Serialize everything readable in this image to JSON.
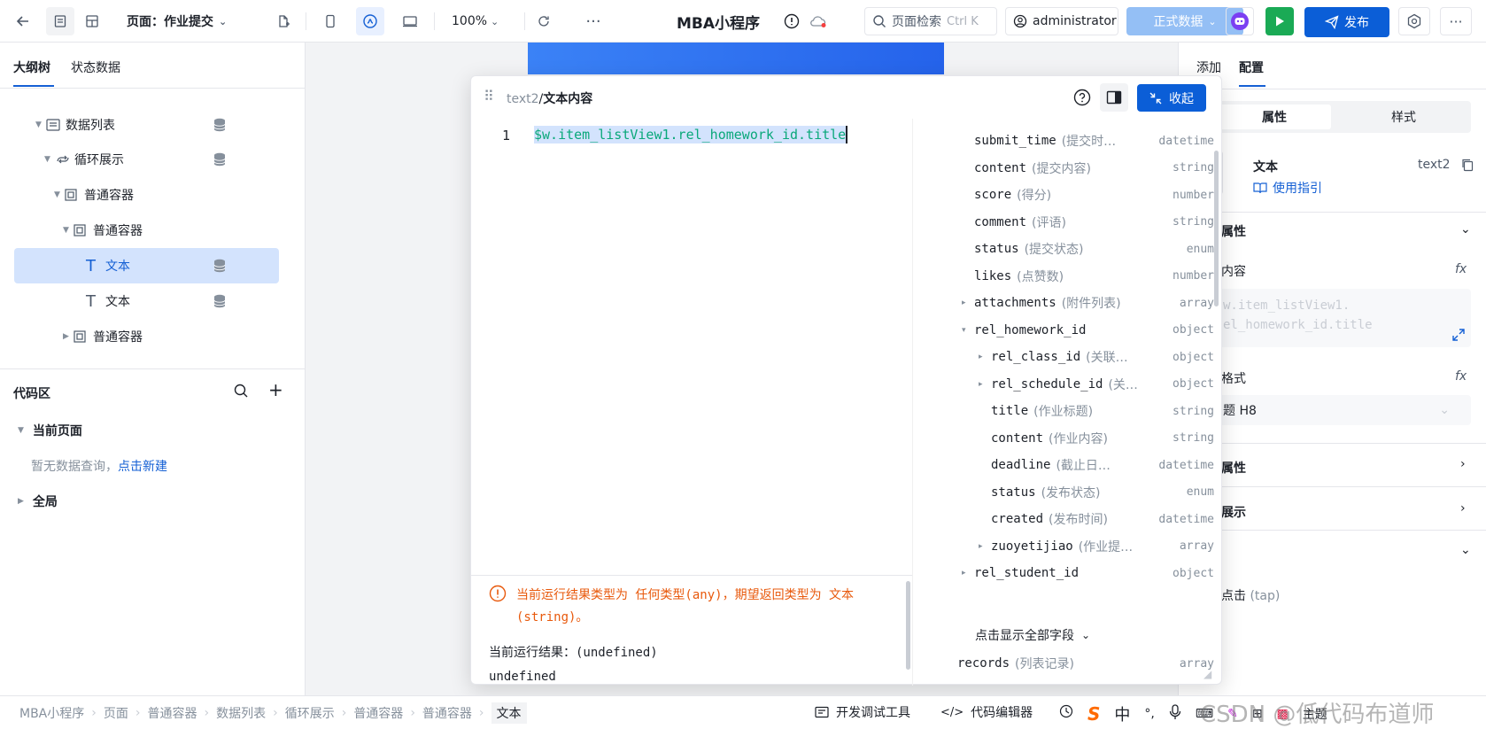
{
  "topbar": {
    "page_label": "页面：作业提交",
    "zoom": "100%",
    "app_title": "MBA小程序",
    "search_placeholder": "页面检索",
    "search_shortcut": "Ctrl K",
    "user": "administrator",
    "env": "正式数据",
    "publish": "发布"
  },
  "left": {
    "tabs": [
      "大纲树",
      "状态数据"
    ],
    "tree": [
      {
        "label": "数据列表"
      },
      {
        "label": "循环展示"
      },
      {
        "label": "普通容器"
      },
      {
        "label": "普通容器"
      },
      {
        "label": "文本"
      },
      {
        "label": "文本"
      },
      {
        "label": "普通容器"
      }
    ],
    "code_title": "代码区",
    "current_page": "当前页面",
    "empty_hint": "暂无数据查询，",
    "create_link": "点击新建",
    "global": "全局"
  },
  "popup": {
    "breadcrumb_parent": "text2",
    "breadcrumb_sep": "/",
    "breadcrumb_current": "文本内容",
    "collapse": "收起",
    "line_no": "1",
    "code": "$w.item_listView1.rel_homework_id.title",
    "warning": "当前运行结果类型为 任何类型(any)，期望返回类型为 文本(string)。",
    "result_label": "当前运行结果：(undefined)",
    "result_value": "undefined",
    "fields": [
      {
        "name": "submit_time",
        "desc": "(提交时…",
        "type": "datetime",
        "level": 0,
        "caret": ""
      },
      {
        "name": "content",
        "desc": "(提交内容)",
        "type": "string",
        "level": 0,
        "caret": ""
      },
      {
        "name": "score",
        "desc": "(得分)",
        "type": "number",
        "level": 0,
        "caret": ""
      },
      {
        "name": "comment",
        "desc": "(评语)",
        "type": "string",
        "level": 0,
        "caret": ""
      },
      {
        "name": "status",
        "desc": "(提交状态)",
        "type": "enum",
        "level": 0,
        "caret": ""
      },
      {
        "name": "likes",
        "desc": "(点赞数)",
        "type": "number",
        "level": 0,
        "caret": ""
      },
      {
        "name": "attachments",
        "desc": "(附件列表)",
        "type": "array",
        "level": 0,
        "caret": "▸"
      },
      {
        "name": "rel_homework_id",
        "desc": "",
        "type": "object",
        "level": 0,
        "caret": "▾"
      },
      {
        "name": "rel_class_id",
        "desc": "(关联…",
        "type": "object",
        "level": 1,
        "caret": "▸"
      },
      {
        "name": "rel_schedule_id",
        "desc": "(关…",
        "type": "object",
        "level": 1,
        "caret": "▸"
      },
      {
        "name": "title",
        "desc": "(作业标题)",
        "type": "string",
        "level": 1,
        "caret": ""
      },
      {
        "name": "content",
        "desc": "(作业内容)",
        "type": "string",
        "level": 1,
        "caret": ""
      },
      {
        "name": "deadline",
        "desc": "(截止日…",
        "type": "datetime",
        "level": 1,
        "caret": ""
      },
      {
        "name": "status",
        "desc": "(发布状态)",
        "type": "enum",
        "level": 1,
        "caret": ""
      },
      {
        "name": "created",
        "desc": "(发布时间)",
        "type": "datetime",
        "level": 1,
        "caret": ""
      },
      {
        "name": "zuoyetijiao",
        "desc": "(作业提…",
        "type": "array",
        "level": 1,
        "caret": "▸"
      },
      {
        "name": "rel_student_id",
        "desc": "",
        "type": "object",
        "level": 0,
        "caret": "▸"
      }
    ],
    "show_all": "点击显示全部字段",
    "records_name": "records",
    "records_desc": "(列表记录)",
    "records_type": "array"
  },
  "right": {
    "tabs": [
      "添加",
      "配置"
    ],
    "subtabs": [
      "属性",
      "样式"
    ],
    "comp_name": "文本",
    "comp_id": "text2",
    "guide": "使用指引",
    "section_basic": "属性",
    "content_label": "内容",
    "content_value": "w.item_listView1.\nel_homework_id.title",
    "format_label": "格式",
    "format_value": "题 H8",
    "section2": "属性",
    "section3": "展示",
    "event_label": "点击",
    "event_tap": "(tap)",
    "fx": "fx"
  },
  "footer": {
    "crumbs": [
      "MBA小程序",
      "页面",
      "普通容器",
      "数据列表",
      "循环展示",
      "普通容器",
      "普通容器",
      "文本"
    ],
    "devtools": "开发调试工具",
    "code_editor": "代码编辑器",
    "ime_zh": "中",
    "watermark": "CSDN @低代码布道师",
    "theme": "主题"
  },
  "colors": {
    "primary": "#0b5ed7",
    "accent": "#1560d4",
    "warning": "#e8590c",
    "code_green": "#0aa87a",
    "run_green": "#1aaa55",
    "env_blue": "#94bff5"
  }
}
